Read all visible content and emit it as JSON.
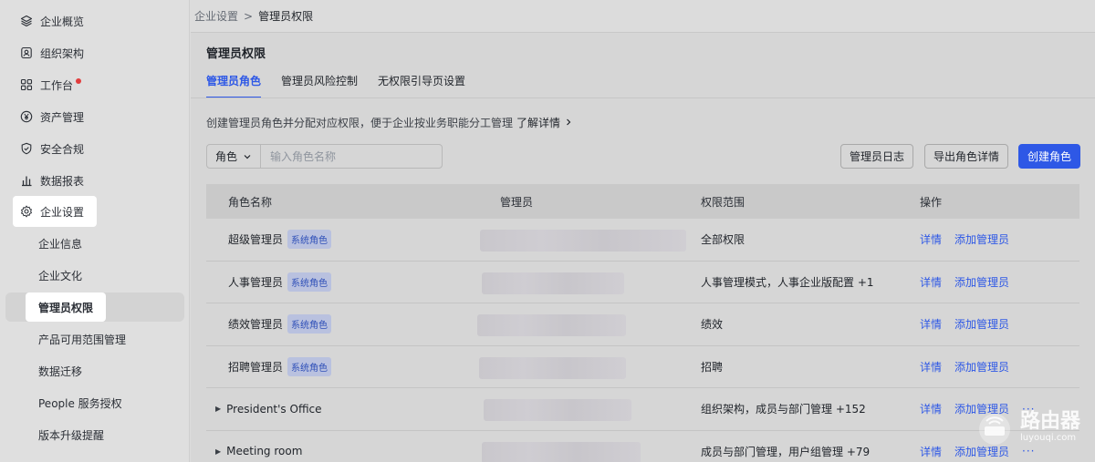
{
  "breadcrumb": {
    "parent": "企业设置",
    "separator": ">",
    "current": "管理员权限"
  },
  "sidebar": {
    "items": [
      {
        "label": "企业概览",
        "icon": "layers-icon"
      },
      {
        "label": "组织架构",
        "icon": "contacts-icon"
      },
      {
        "label": "工作台",
        "icon": "grid-icon"
      },
      {
        "label": "资产管理",
        "icon": "yen-icon"
      },
      {
        "label": "安全合规",
        "icon": "shield-check-icon"
      },
      {
        "label": "数据报表",
        "icon": "bar-chart-icon"
      },
      {
        "label": "企业设置",
        "icon": "gear-icon"
      }
    ],
    "sub_items": [
      {
        "label": "企业信息"
      },
      {
        "label": "企业文化"
      },
      {
        "label": "管理员权限"
      },
      {
        "label": "产品可用范围管理"
      },
      {
        "label": "数据迁移"
      },
      {
        "label": "People 服务授权"
      },
      {
        "label": "版本升级提醒"
      }
    ]
  },
  "main": {
    "title": "管理员权限",
    "tabs": [
      {
        "label": "管理员角色"
      },
      {
        "label": "管理员风险控制"
      },
      {
        "label": "无权限引导页设置"
      }
    ],
    "description": "创建管理员角色并分配对应权限，便于企业按业务职能分工管理",
    "learn_more": "了解详情",
    "filter": {
      "select_label": "角色",
      "placeholder": "输入角色名称"
    },
    "buttons": {
      "log": "管理员日志",
      "export": "导出角色详情",
      "create": "创建角色"
    }
  },
  "table": {
    "headers": {
      "name": "角色名称",
      "admin": "管理员",
      "scope": "权限范围",
      "ops": "操作"
    },
    "rows": [
      {
        "name": "超级管理员",
        "badge": "系统角色",
        "scope": "全部权限",
        "detail": "详情",
        "add": "添加管理员",
        "more": ""
      },
      {
        "name": "人事管理员",
        "badge": "系统角色",
        "scope": "人事管理模式，人事企业版配置 +1",
        "detail": "详情",
        "add": "添加管理员",
        "more": ""
      },
      {
        "name": "绩效管理员",
        "badge": "系统角色",
        "scope": "绩效",
        "detail": "详情",
        "add": "添加管理员",
        "more": ""
      },
      {
        "name": "招聘管理员",
        "badge": "系统角色",
        "scope": "招聘",
        "detail": "详情",
        "add": "添加管理员",
        "more": ""
      },
      {
        "name": "President's Office",
        "badge": "",
        "scope": "组织架构，成员与部门管理 +152",
        "detail": "详情",
        "add": "添加管理员",
        "more": "···"
      },
      {
        "name": "Meeting room",
        "badge": "",
        "scope": "成员与部门管理，用户组管理 +79",
        "detail": "详情",
        "add": "添加管理员",
        "more": "···"
      }
    ]
  },
  "watermark": {
    "title": "路由器",
    "url": "luyouqi.com"
  },
  "colors": {
    "accent": "#2e58e6",
    "notification_dot": "#e23d3d",
    "badge_bg": "#b9c1df"
  }
}
